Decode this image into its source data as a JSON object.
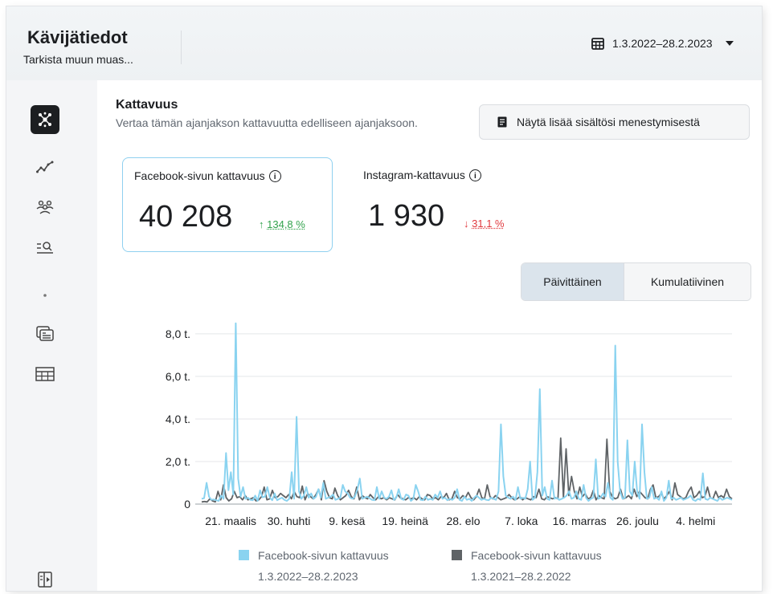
{
  "header": {
    "title": "Kävijätiedot",
    "subtitle": "Tarkista muun muas...",
    "date_range": "1.3.2022–28.2.2023"
  },
  "sidebar": {
    "items": [
      {
        "icon": "network-icon",
        "active": true
      },
      {
        "icon": "trend-line-icon"
      },
      {
        "icon": "people-group-icon"
      },
      {
        "icon": "search-list-icon"
      },
      {
        "icon": "dot-icon"
      },
      {
        "icon": "content-cards-icon"
      },
      {
        "icon": "table-icon"
      },
      {
        "icon": "collapse-panel-icon"
      }
    ]
  },
  "section": {
    "title": "Kattavuus",
    "description": "Vertaa tämän ajanjakson kattavuutta edelliseen ajanjaksoon.",
    "more_button": "Näytä lisää sisältösi menestymisestä"
  },
  "metrics": [
    {
      "label": "Facebook-sivun kattavuus",
      "value": "40 208",
      "arrow": "↑",
      "delta": "134,8 %",
      "trend": "up",
      "selected": true
    },
    {
      "label": "Instagram-kattavuus",
      "value": "1 930",
      "arrow": "↓",
      "delta": "31,1 %",
      "trend": "down",
      "selected": false
    }
  ],
  "toggle": {
    "daily": "Päivittäinen",
    "cumulative": "Kumulatiivinen",
    "active": "daily"
  },
  "chart_data": {
    "type": "line",
    "y_tick_labels": [
      "0",
      "2,0 t.",
      "4,0 t.",
      "6,0 t.",
      "8,0 t."
    ],
    "y_ticks": [
      0,
      2000,
      4000,
      6000,
      8000
    ],
    "ylim": [
      0,
      8600
    ],
    "x_tick_labels": [
      "21. maalis",
      "30. huhti",
      "9. kesä",
      "19. heinä",
      "28. elo",
      "7. loka",
      "16. marras",
      "26. joulu",
      "4. helmi"
    ],
    "x_tick_days": [
      20,
      60,
      100,
      140,
      180,
      220,
      260,
      300,
      340
    ],
    "grid": true,
    "colors": {
      "current": "#8ad3f0",
      "previous": "#5f6366"
    },
    "series": [
      {
        "name": "Facebook-sivun kattavuus",
        "period": "1.3.2022–28.2.2023",
        "color": "#8ad3f0",
        "values": [
          250,
          280,
          1000,
          350,
          200,
          220,
          180,
          150,
          400,
          250,
          2400,
          650,
          1500,
          450,
          8500,
          1200,
          350,
          800,
          250,
          300,
          200,
          180,
          400,
          150,
          650,
          320,
          350,
          800,
          300,
          180,
          500,
          180,
          250,
          300,
          200,
          150,
          250,
          1500,
          250,
          4100,
          600,
          250,
          400,
          800,
          300,
          500,
          250,
          350,
          700,
          300,
          1000,
          250,
          300,
          350,
          450,
          200,
          250,
          300,
          900,
          600,
          500,
          300,
          250,
          350,
          700,
          1200,
          250,
          300,
          350,
          280,
          200,
          180,
          800,
          250,
          600,
          300,
          250,
          350,
          650,
          200,
          300,
          700,
          250,
          200,
          450,
          400,
          150,
          250,
          900,
          600,
          200,
          180,
          350,
          200,
          250,
          200,
          450,
          300,
          600,
          250,
          300,
          180,
          250,
          200,
          300,
          700,
          200,
          150,
          350,
          200,
          250,
          150,
          300,
          400,
          300,
          200,
          250,
          200,
          180,
          300,
          250,
          200,
          600,
          3750,
          1300,
          400,
          300,
          250,
          350,
          200,
          800,
          250,
          300,
          250,
          700,
          2000,
          200,
          300,
          1500,
          5400,
          400,
          800,
          250,
          200,
          1100,
          250,
          300,
          200,
          250,
          300,
          400,
          600,
          250,
          300,
          600,
          250,
          200,
          900,
          300,
          150,
          250,
          300,
          2100,
          250,
          300,
          500,
          350,
          1000,
          300,
          200,
          7450,
          2000,
          600,
          250,
          300,
          3000,
          600,
          400,
          2000,
          600,
          250,
          3750,
          1500,
          250,
          300,
          800,
          250,
          300,
          200,
          600,
          150,
          300,
          1100,
          250,
          300,
          200,
          250,
          300,
          200,
          250,
          300,
          400,
          200,
          150,
          250,
          200,
          1450,
          250,
          200,
          300,
          250,
          200,
          150,
          300,
          200,
          250,
          300,
          250,
          200
        ],
        "note_values": "daily reach values, approximately 220 samples across the period"
      },
      {
        "name": "Facebook-sivun kattavuus",
        "period": "1.3.2021–28.2.2022",
        "color": "#5f6366",
        "values": [
          100,
          120,
          100,
          250,
          150,
          100,
          600,
          200,
          900,
          300,
          150,
          250,
          600,
          300,
          350,
          200,
          400,
          200,
          250,
          300,
          150,
          200,
          350,
          800,
          200,
          250,
          650,
          300,
          350,
          500,
          400,
          300,
          450,
          250,
          600,
          350,
          300,
          850,
          200,
          500,
          350,
          250,
          450,
          700,
          200,
          1100,
          600,
          300,
          250,
          750,
          400,
          200,
          300,
          400,
          650,
          350,
          250,
          800,
          200,
          400,
          300,
          250,
          450,
          300,
          200,
          350,
          250,
          300,
          200,
          300,
          250,
          200,
          450,
          300,
          250,
          200,
          300,
          250,
          300,
          200,
          350,
          250,
          200,
          450,
          400,
          250,
          300,
          200,
          350,
          300,
          500,
          200,
          250,
          600,
          300,
          250,
          400,
          300,
          550,
          300,
          200,
          350,
          700,
          300,
          250,
          900,
          350,
          250,
          400,
          300,
          200,
          250,
          300,
          450,
          300,
          200,
          250,
          350,
          200,
          300,
          250,
          200,
          350,
          300,
          700,
          250,
          200,
          350,
          300,
          250,
          300,
          250,
          3100,
          300,
          2600,
          400,
          1300,
          600,
          250,
          800,
          350,
          500,
          250,
          300,
          650,
          200,
          400,
          300,
          250,
          3050,
          600,
          350,
          250,
          300,
          700,
          250,
          300,
          400,
          250,
          700,
          350,
          600,
          450,
          300,
          250,
          700,
          900,
          300,
          350,
          500,
          250,
          400,
          600,
          200,
          1000,
          450,
          350,
          250,
          300,
          600,
          800,
          300,
          400,
          600,
          300,
          350,
          800,
          300,
          250,
          600,
          300,
          400,
          300,
          700,
          350,
          250
        ]
      }
    ]
  },
  "legend": [
    {
      "label": "Facebook-sivun kattavuus",
      "period": "1.3.2022–28.2.2023",
      "color": "#8ad3f0"
    },
    {
      "label": "Facebook-sivun kattavuus",
      "period": "1.3.2021–28.2.2022",
      "color": "#5f6366"
    }
  ]
}
